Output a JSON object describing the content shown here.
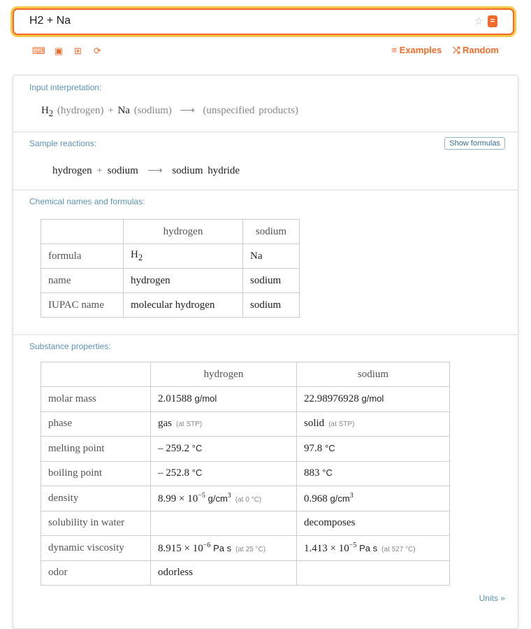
{
  "search": {
    "value": "H2 + Na"
  },
  "toolbar": {
    "icons": [
      "keyboard-icon",
      "camera-icon",
      "grid-icon",
      "upload-icon"
    ],
    "examples": "≡ Examples",
    "random": "⤮ Random"
  },
  "input_interpretation": {
    "label": "Input interpretation:",
    "h": "H",
    "h_sub": "2",
    "h_name": "(hydrogen)",
    "plus": "+",
    "na": "Na",
    "na_name": "(sodium)",
    "arrow": "⟶",
    "products": "(unspecified products)"
  },
  "sample_reactions": {
    "label": "Sample reactions:",
    "show_formulas": "Show formulas",
    "r1": "hydrogen",
    "plus": "+",
    "r2": "sodium",
    "arrow": "⟶",
    "product": "sodium hydride"
  },
  "chem_names": {
    "label": "Chemical names and formulas:",
    "headers": [
      "hydrogen",
      "sodium"
    ],
    "rows": [
      {
        "label": "formula",
        "h": "H",
        "h_sub": "2",
        "na": "Na"
      },
      {
        "label": "name",
        "h": "hydrogen",
        "na": "sodium"
      },
      {
        "label": "IUPAC name",
        "h": "molecular hydrogen",
        "na": "sodium"
      }
    ]
  },
  "substance": {
    "label": "Substance properties:",
    "headers": [
      "hydrogen",
      "sodium"
    ],
    "rows": [
      {
        "label": "molar mass",
        "h": {
          "v": "2.01588",
          "u": "g/mol"
        },
        "na": {
          "v": "22.98976928",
          "u": "g/mol"
        }
      },
      {
        "label": "phase",
        "h": {
          "v": "gas",
          "n": "(at STP)"
        },
        "na": {
          "v": "solid",
          "n": "(at STP)"
        }
      },
      {
        "label": "melting point",
        "h": {
          "v": "– 259.2",
          "u": "°C"
        },
        "na": {
          "v": "97.8",
          "u": "°C"
        }
      },
      {
        "label": "boiling point",
        "h": {
          "v": "– 252.8",
          "u": "°C"
        },
        "na": {
          "v": "883",
          "u": "°C"
        }
      },
      {
        "label": "density",
        "h": {
          "v": "8.99 × 10",
          "e": "−5",
          "u": "g/cm",
          "ue": "3",
          "n": "(at 0 °C)"
        },
        "na": {
          "v": "0.968",
          "u": "g/cm",
          "ue": "3"
        }
      },
      {
        "label": "solubility in water",
        "h": {},
        "na": {
          "v": "decomposes"
        }
      },
      {
        "label": "dynamic viscosity",
        "h": {
          "v": "8.915 × 10",
          "e": "−6",
          "u": "Pa s",
          "n": "(at 25 °C)"
        },
        "na": {
          "v": "1.413 × 10",
          "e": "−5",
          "u": "Pa s",
          "n": "(at 527 °C)"
        }
      },
      {
        "label": "odor",
        "h": {
          "v": "odorless"
        },
        "na": {}
      }
    ]
  },
  "units": "Units »"
}
